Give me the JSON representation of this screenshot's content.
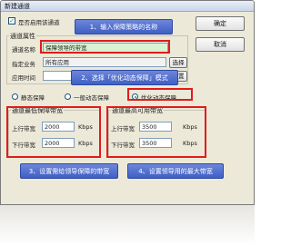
{
  "window": {
    "title": "新建通道"
  },
  "top": {
    "enable_channel_label": "是否启用该通道",
    "enable_checked": "✓"
  },
  "buttons": {
    "ok": "确定",
    "cancel": "取消",
    "select": "选择",
    "config": "配置"
  },
  "channel_props": {
    "legend": "通道属性",
    "name_label": "通道名称",
    "name_value": "保障领导的带宽",
    "service_label": "指定业务",
    "service_value": "所有应用",
    "time_label": "应用时间"
  },
  "mode": {
    "static": "静态保障",
    "general": "一般动态保障",
    "optimized": "优化动态保障"
  },
  "min_guarantee": {
    "legend": "通道最低保障带宽",
    "up_label": "上行带宽",
    "up_value": "2000",
    "down_label": "下行带宽",
    "down_value": "2000",
    "unit": "Kbps"
  },
  "max_available": {
    "legend": "通道最高可用带宽",
    "up_label": "上行带宽",
    "up_value": "3500",
    "down_label": "下行带宽",
    "down_value": "3500",
    "unit": "Kbps"
  },
  "callouts": {
    "step1": "1、输入保障策略的名称",
    "step2": "2、选择「优化动态保障」模式",
    "step3": "3、设置需给领导保障的带宽",
    "step4": "4、设置领导用的最大带宽"
  }
}
